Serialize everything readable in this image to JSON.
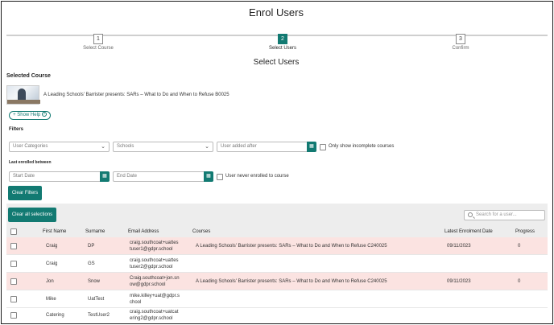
{
  "page": {
    "title": "Enrol Users",
    "subtitle": "Select Users"
  },
  "steps": [
    {
      "number": "1",
      "label": "Select Course"
    },
    {
      "number": "2",
      "label": "Select Users"
    },
    {
      "number": "3",
      "label": "Confirm"
    }
  ],
  "selected_course": {
    "heading": "Selected Course",
    "name": "A Leading Schools' Barrister presents: SARs – What to Do and When to Refuse B0025",
    "help_label": "+ Show Help"
  },
  "filters": {
    "heading": "Filters",
    "user_categories_placeholder": "User Categories",
    "schools_placeholder": "Schools",
    "user_added_after_placeholder": "User added after",
    "incomplete_label": "Only show incomplete courses",
    "last_enrolled_heading": "Last enrolled between",
    "start_date_placeholder": "Start Date",
    "end_date_placeholder": "End Date",
    "never_enrolled_label": "User never enrolled to course",
    "clear_filters_label": "Clear Filters"
  },
  "table": {
    "clear_selections_label": "Clear all selections",
    "search_placeholder": "Search for a user...",
    "columns": [
      "First Name",
      "Surname",
      "Email Address",
      "Courses",
      "Latest Enrolment Date",
      "Progress"
    ],
    "rows": [
      {
        "first": "Craig",
        "surname": "DP",
        "email1": "craig.southcoat+uattes",
        "email2": "tuser1@gdpr.school",
        "course": "A Leading Schools' Barrister presents: SARs – What to Do and When to Refuse  C240025",
        "date": "09/11/2023",
        "progress": "0",
        "highlight": true
      },
      {
        "first": "Craig",
        "surname": "GS",
        "email1": "craig.southcoat+uattes",
        "email2": "tuser2@gdpr.school",
        "course": "",
        "date": "",
        "progress": "",
        "highlight": false
      },
      {
        "first": "Jon",
        "surname": "Snow",
        "email1": "Craig.southcoat+jon.sn",
        "email2": "ow@gdpr.school",
        "course": "A Leading Schools' Barrister presents: SARs – What to Do and When to Refuse  C240025",
        "date": "09/11/2023",
        "progress": "0",
        "highlight": true
      },
      {
        "first": "Mike",
        "surname": "UatTest",
        "email1": "mike.killey+uat@gdpr.s",
        "email2": "chool",
        "course": "",
        "date": "",
        "progress": "",
        "highlight": false
      },
      {
        "first": "Catering",
        "surname": "TestUser2",
        "email1": "craig.southcoat+uatcat",
        "email2": "ering2@gdpr.school",
        "course": "",
        "date": "",
        "progress": "",
        "highlight": false
      }
    ]
  },
  "icons": {
    "calendar": "calendar-icon",
    "chevron": "chevron-down-icon",
    "search": "search-icon"
  },
  "colors": {
    "accent": "#127a72",
    "row_highlight": "#fbe3e1"
  }
}
